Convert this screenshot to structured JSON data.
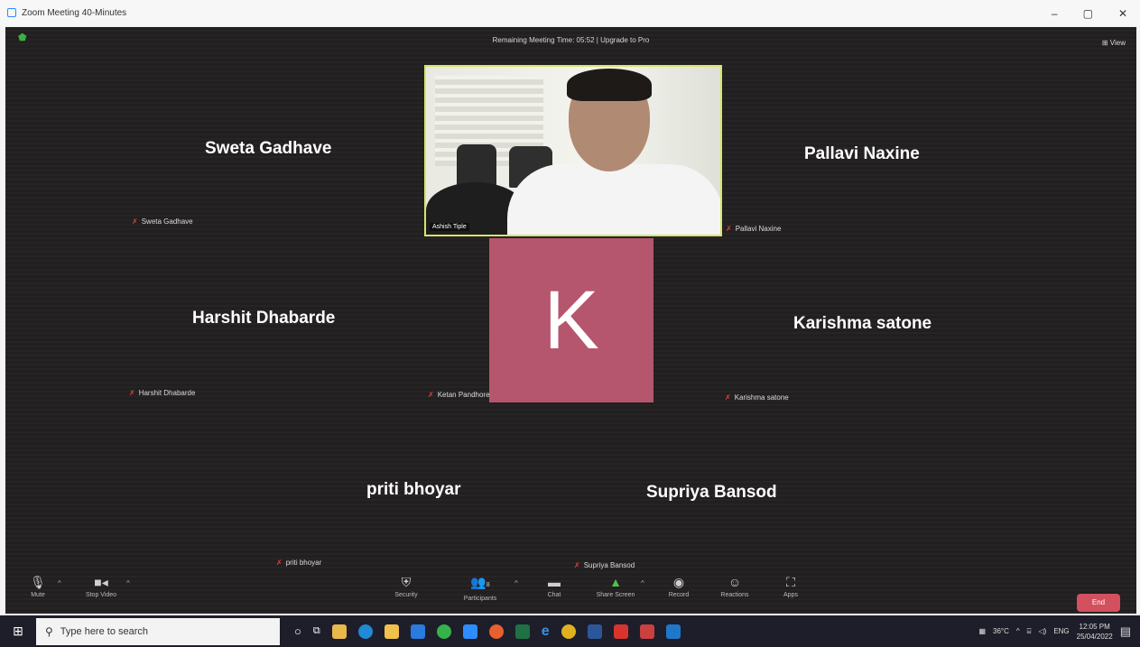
{
  "window": {
    "title": "Zoom Meeting 40-Minutes",
    "minimize": "–",
    "maximize": "▢",
    "close": "✕"
  },
  "meeting": {
    "timer": "Remaining Meeting Time: 05:52 | Upgrade to Pro",
    "view": "⊞ View",
    "active_video_label": "Ashish Tiple",
    "avatar_letter": "K",
    "tiles": [
      {
        "name": "Sweta Gadhave",
        "label": "Sweta Gadhave"
      },
      {
        "name": "Pallavi Naxine",
        "label": "Pallavi Naxine"
      },
      {
        "name": "Harshit Dhabarde",
        "label": "Harshit Dhabarde"
      },
      {
        "name": "",
        "label": "Ketan Pandhore"
      },
      {
        "name": "Karishma satone",
        "label": "Karishma satone"
      },
      {
        "name": "priti bhoyar",
        "label": "priti bhoyar"
      },
      {
        "name": "Supriya Bansod",
        "label": "Supriya Bansod"
      }
    ]
  },
  "toolbar": {
    "mute": "Mute",
    "stop_video": "Stop Video",
    "security": "Security",
    "participants": "Participants",
    "participants_count": "8",
    "chat": "Chat",
    "share_screen": "Share Screen",
    "record": "Record",
    "reactions": "Reactions",
    "apps": "Apps",
    "end": "End"
  },
  "taskbar": {
    "search_placeholder": "Type here to search",
    "weather": "36°C",
    "language": "ENG",
    "time": "12:05 PM",
    "date": "25/04/2022"
  },
  "colors": {
    "avatar_bg": "#b5566e",
    "end_button": "#d3505f",
    "active_speaker_border": "#d7e46a"
  }
}
